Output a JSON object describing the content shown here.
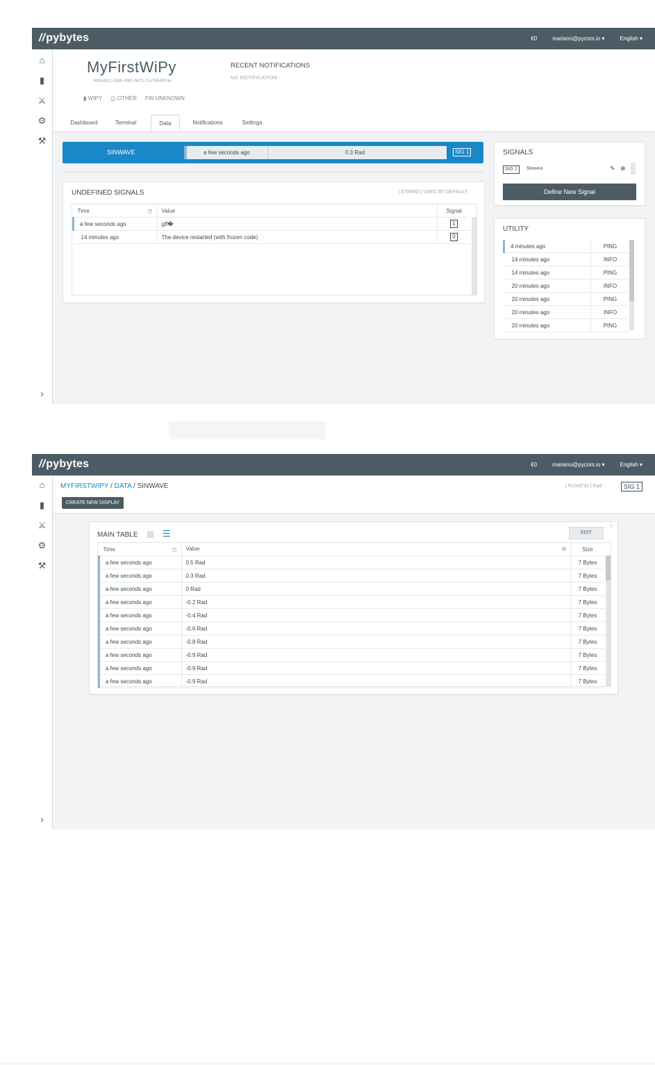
{
  "brand": "pybytes",
  "topbar": {
    "credit": "€0",
    "user": "mariano@pycom.io ▾",
    "language": "English ▾"
  },
  "screen1": {
    "device_name": "MyFirstWiPy",
    "device_id": "6b9c4911-5989-4987-9d71-7ce79548f74e",
    "device_tags": [
      "WIPY",
      "OTHER",
      "FW UNKNOWN"
    ],
    "recent_notifications": {
      "title": "RECENT NOTIFICATIONS",
      "empty": "NO NOTIFICATION"
    },
    "tabs": [
      "Dashboard",
      "Terminal",
      "Data",
      "Notifications",
      "Settings"
    ],
    "active_tab": "Data",
    "signal_bar": {
      "name": "SINWAVE",
      "time": "a few seconds ago",
      "value": "0.3 Rad",
      "sig": "SIG 1"
    },
    "undefined_signals": {
      "title": "UNDEFINED SIGNALS",
      "hint": "[ STRING ] USED BY DEFAULT",
      "columns": [
        "Time",
        "Value",
        "Signal"
      ],
      "rows": [
        {
          "time": "a few seconds ago",
          "value": "gff�",
          "signal": "1"
        },
        {
          "time": "14 minutes ago",
          "value": "The device restarted (with frozen code)",
          "signal": "0"
        }
      ]
    },
    "signals_panel": {
      "title": "SIGNALS",
      "sig": "SIG 1",
      "name": "Sinwave",
      "button": "Define New Signal"
    },
    "utility": {
      "title": "UTILITY",
      "rows": [
        {
          "time": "4 minutes ago",
          "type": "PING"
        },
        {
          "time": "14 minutes ago",
          "type": "INFO"
        },
        {
          "time": "14 minutes ago",
          "type": "PING"
        },
        {
          "time": "20 minutes ago",
          "type": "INFO"
        },
        {
          "time": "20 minutes ago",
          "type": "PING"
        },
        {
          "time": "20 minutes ago",
          "type": "INFO"
        },
        {
          "time": "20 minutes ago",
          "type": "PING"
        }
      ]
    }
  },
  "screen2": {
    "breadcrumb": [
      "MYFIRSTWIPY",
      "DATA",
      "SINWAVE"
    ],
    "type_info": "[ FLOAT32 ] Rad",
    "sig": "SIG 1",
    "create_button": "CREATE NEW DISPLAY",
    "main_table": {
      "title": "MAIN TABLE",
      "edit": "EDIT",
      "columns": [
        "Time",
        "Value",
        "Size"
      ],
      "rows": [
        {
          "time": "a few seconds ago",
          "value": "0.5 Rad",
          "size": "7 Bytes"
        },
        {
          "time": "a few seconds ago",
          "value": "0.3 Rad",
          "size": "7 Bytes"
        },
        {
          "time": "a few seconds ago",
          "value": "0 Rad",
          "size": "7 Bytes"
        },
        {
          "time": "a few seconds ago",
          "value": "-0.2 Rad",
          "size": "7 Bytes"
        },
        {
          "time": "a few seconds ago",
          "value": "-0.4 Rad",
          "size": "7 Bytes"
        },
        {
          "time": "a few seconds ago",
          "value": "-0.6 Rad",
          "size": "7 Bytes"
        },
        {
          "time": "a few seconds ago",
          "value": "-0.8 Rad",
          "size": "7 Bytes"
        },
        {
          "time": "a few seconds ago",
          "value": "-0.9 Rad",
          "size": "7 Bytes"
        },
        {
          "time": "a few seconds ago",
          "value": "-0.9 Rad",
          "size": "7 Bytes"
        },
        {
          "time": "a few seconds ago",
          "value": "-0.9 Rad",
          "size": "7 Bytes"
        }
      ]
    }
  },
  "icons": [
    "home-icon",
    "chip-icon",
    "stethoscope-icon",
    "gear-icon",
    "wrench-icon",
    "chevron-right-icon"
  ],
  "colors": {
    "topbar": "#4d5c64",
    "accent_blue": "#1a87c9",
    "row_accent": "#8ab8d6"
  }
}
